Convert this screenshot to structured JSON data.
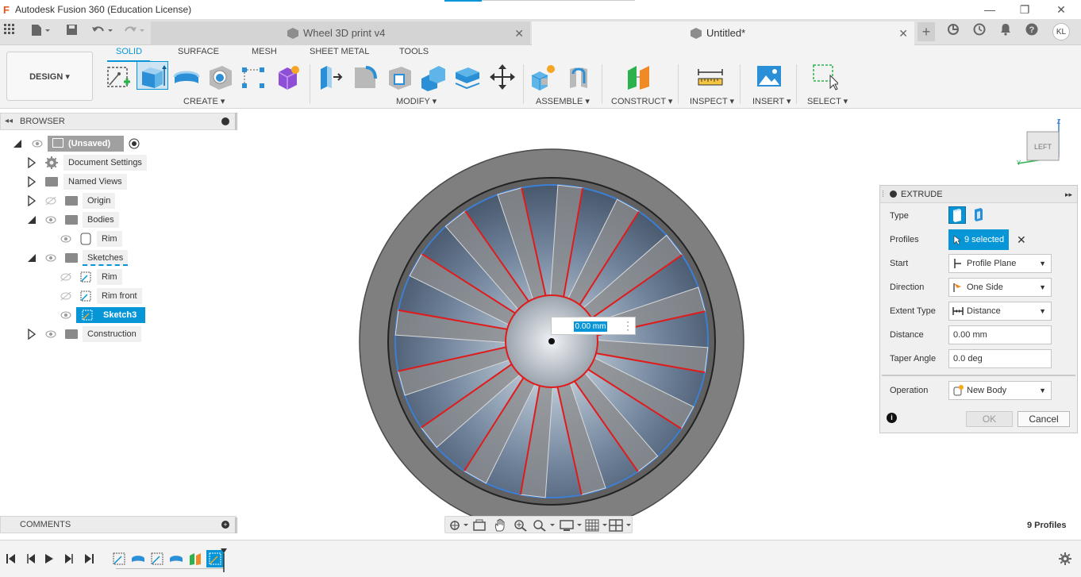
{
  "window": {
    "title": "Autodesk Fusion 360 (Education License)",
    "minimize": "—",
    "restore": "❐",
    "close": "✕"
  },
  "tabs": {
    "inactive_tab": "Wheel 3D print v4",
    "active_tab": "Untitled*",
    "close_glyph": "✕",
    "new_tab": "+",
    "user_initials": "KL"
  },
  "toolbar": {
    "workspace": "DESIGN",
    "workspace_tabs": [
      "SOLID",
      "SURFACE",
      "MESH",
      "SHEET METAL",
      "TOOLS"
    ],
    "groups": {
      "create": "CREATE",
      "modify": "MODIFY",
      "assemble": "ASSEMBLE",
      "construct": "CONSTRUCT",
      "inspect": "INSPECT",
      "insert": "INSERT",
      "select": "SELECT"
    },
    "accent_color": "#0696d7"
  },
  "browser": {
    "title": "BROWSER",
    "items": [
      {
        "label": "(Unsaved)"
      },
      {
        "label": "Document Settings"
      },
      {
        "label": "Named Views"
      },
      {
        "label": "Origin"
      },
      {
        "label": "Bodies"
      },
      {
        "label": "Rim"
      },
      {
        "label": "Sketches"
      },
      {
        "label": "Rim"
      },
      {
        "label": "Rim front"
      },
      {
        "label": "Sketch3"
      },
      {
        "label": "Construction"
      }
    ]
  },
  "viewport": {
    "viewcube_face": "LEFT",
    "viewcube_axis_z": "Z",
    "viewcube_axis_y": "Y",
    "distance_input": "0.00 mm",
    "profile_color": "#e01b1b",
    "edge_color": "#3b7fd6"
  },
  "extrude": {
    "title": "EXTRUDE",
    "rows": {
      "type": "Type",
      "profiles": "Profiles",
      "start": "Start",
      "direction": "Direction",
      "extent_type": "Extent Type",
      "distance": "Distance",
      "taper_angle": "Taper Angle",
      "operation": "Operation"
    },
    "values": {
      "profiles": "9 selected",
      "start": "Profile Plane",
      "direction": "One Side",
      "extent_type": "Distance",
      "distance": "0.00 mm",
      "taper_angle": "0.0 deg",
      "operation": "New Body"
    },
    "ok": "OK",
    "cancel": "Cancel"
  },
  "comments": {
    "title": "COMMENTS"
  },
  "status": {
    "profiles": "9 Profiles"
  }
}
